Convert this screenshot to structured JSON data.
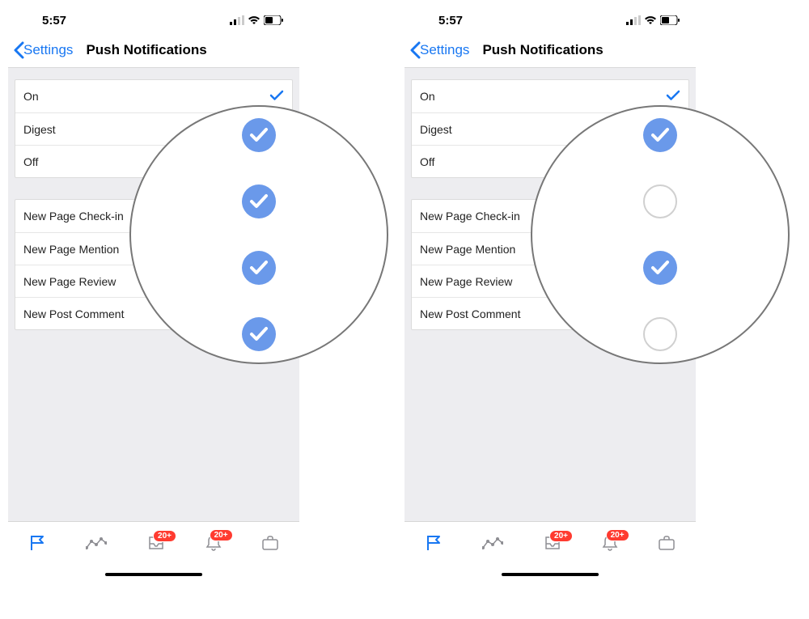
{
  "status": {
    "time": "5:57"
  },
  "nav": {
    "back": "Settings",
    "title": "Push Notifications"
  },
  "group1": {
    "rows": [
      {
        "label": "On",
        "checked": true
      },
      {
        "label": "Digest",
        "checked": false
      },
      {
        "label": "Off",
        "checked": false
      }
    ]
  },
  "group2": {
    "rows": [
      {
        "label": "New Page Check-in"
      },
      {
        "label": "New Page Mention"
      },
      {
        "label": "New Page Review"
      },
      {
        "label": "New Post Comment"
      }
    ]
  },
  "badges": {
    "inbox": "20+",
    "notifications": "20+"
  },
  "magnifier_left": {
    "states": [
      "on",
      "on",
      "on",
      "on"
    ]
  },
  "magnifier_right": {
    "states": [
      "on",
      "off",
      "on",
      "off"
    ]
  }
}
